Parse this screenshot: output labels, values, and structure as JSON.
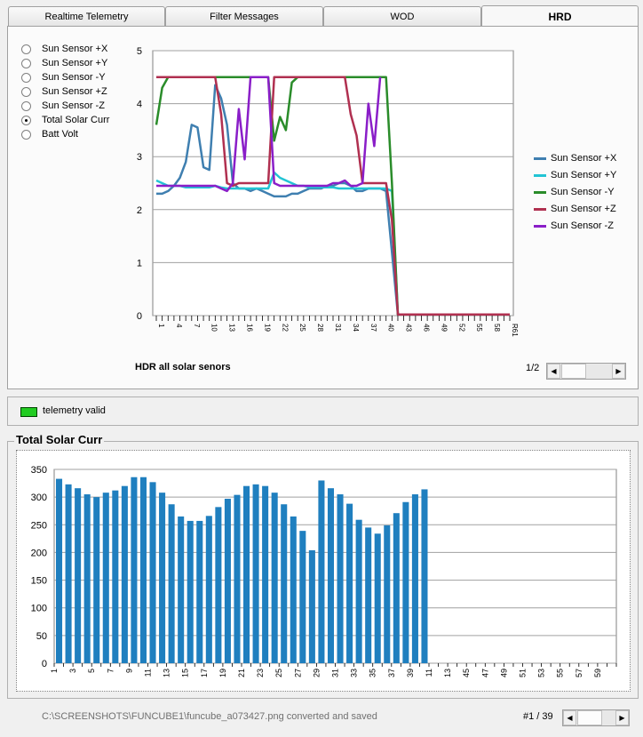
{
  "tabs": [
    {
      "label": "Realtime Telemetry"
    },
    {
      "label": "Filter Messages"
    },
    {
      "label": "WOD"
    },
    {
      "label": "HRD",
      "active": true
    }
  ],
  "radios": [
    {
      "label": "Sun Sensor +X",
      "checked": false
    },
    {
      "label": "Sun Sensor +Y",
      "checked": false
    },
    {
      "label": "Sun Sensor -Y",
      "checked": false
    },
    {
      "label": "Sun Sensor +Z",
      "checked": false
    },
    {
      "label": "Sun Sensor -Z",
      "checked": false
    },
    {
      "label": "Total Solar Curr",
      "checked": true
    },
    {
      "label": "Batt Volt",
      "checked": false
    }
  ],
  "top_chart_title": "HDR  all solar senors",
  "page_indicator": "1/2",
  "status": {
    "label": "telemetry valid",
    "color": "#22cc22"
  },
  "bottom_group_title": "Total Solar Curr",
  "footer": {
    "message": "C:\\SCREENSHOTS\\FUNCUBE1\\funcube_a073427.png converted and saved",
    "frame_counter": "#1 / 39"
  },
  "chart_data": [
    {
      "type": "line",
      "title": "HDR  all solar senors",
      "ylim": [
        0,
        5
      ],
      "yticks": [
        "0",
        "1",
        "2",
        "3",
        "4",
        "5"
      ],
      "xticks": [
        "1",
        "4",
        "7",
        "10",
        "13",
        "16",
        "19",
        "22",
        "25",
        "28",
        "31",
        "34",
        "37",
        "40",
        "43",
        "46",
        "49",
        "52",
        "55",
        "58",
        "R61"
      ],
      "x": [
        1,
        2,
        3,
        4,
        5,
        6,
        7,
        8,
        9,
        10,
        11,
        12,
        13,
        14,
        15,
        16,
        17,
        18,
        19,
        20,
        21,
        22,
        23,
        24,
        25,
        26,
        27,
        28,
        29,
        30,
        31,
        32,
        33,
        34,
        35,
        36,
        37,
        38,
        39,
        40,
        41,
        42,
        43,
        44,
        45,
        46,
        47,
        48,
        49,
        50,
        51,
        52,
        53,
        54,
        55,
        56,
        57,
        58,
        59,
        60,
        61
      ],
      "series": [
        {
          "name": "Sun Sensor +X",
          "color": "#3f7fb0",
          "values": [
            2.3,
            2.3,
            2.35,
            2.45,
            2.6,
            2.9,
            3.6,
            3.55,
            2.8,
            2.75,
            4.35,
            4.1,
            3.6,
            2.5,
            2.4,
            2.4,
            2.35,
            2.4,
            2.35,
            2.3,
            2.25,
            2.25,
            2.25,
            2.3,
            2.3,
            2.35,
            2.4,
            2.4,
            2.4,
            2.45,
            2.45,
            2.5,
            2.5,
            2.45,
            2.35,
            2.35,
            2.4,
            2.4,
            2.4,
            2.35,
            1.2,
            0.02,
            0.02,
            0.02,
            0.02,
            0.02,
            0.02,
            0.02,
            0.02,
            0.02,
            0.02,
            0.02,
            0.02,
            0.02,
            0.02,
            0.02,
            0.02,
            0.02,
            0.02,
            0.02,
            0.02
          ]
        },
        {
          "name": "Sun Sensor +Y",
          "color": "#22c4d4",
          "values": [
            2.55,
            2.5,
            2.45,
            2.45,
            2.45,
            2.42,
            2.42,
            2.42,
            2.42,
            2.42,
            2.45,
            2.42,
            2.4,
            2.4,
            2.4,
            2.4,
            2.4,
            2.4,
            2.4,
            2.4,
            2.7,
            2.6,
            2.55,
            2.5,
            2.45,
            2.45,
            2.42,
            2.42,
            2.42,
            2.42,
            2.42,
            2.4,
            2.4,
            2.4,
            2.4,
            2.4,
            2.4,
            2.4,
            2.4,
            2.4,
            2.35,
            0.02,
            0.02,
            0.02,
            0.02,
            0.02,
            0.02,
            0.02,
            0.02,
            0.02,
            0.02,
            0.02,
            0.02,
            0.02,
            0.02,
            0.02,
            0.02,
            0.02,
            0.02,
            0.02,
            0.02
          ]
        },
        {
          "name": "Sun Sensor -Y",
          "color": "#2a8c2a",
          "values": [
            3.6,
            4.3,
            4.5,
            4.5,
            4.5,
            4.5,
            4.5,
            4.5,
            4.5,
            4.5,
            4.5,
            4.5,
            4.5,
            4.5,
            4.5,
            4.5,
            4.5,
            4.5,
            4.5,
            4.5,
            3.3,
            3.75,
            3.5,
            4.4,
            4.5,
            4.5,
            4.5,
            4.5,
            4.5,
            4.5,
            4.5,
            4.5,
            4.5,
            4.5,
            4.5,
            4.5,
            4.5,
            4.5,
            4.5,
            4.5,
            2.5,
            0.02,
            0.02,
            0.02,
            0.02,
            0.02,
            0.02,
            0.02,
            0.02,
            0.02,
            0.02,
            0.02,
            0.02,
            0.02,
            0.02,
            0.02,
            0.02,
            0.02,
            0.02,
            0.02,
            0.02
          ]
        },
        {
          "name": "Sun Sensor +Z",
          "color": "#b03050",
          "values": [
            4.5,
            4.5,
            4.5,
            4.5,
            4.5,
            4.5,
            4.5,
            4.5,
            4.5,
            4.5,
            4.5,
            3.8,
            2.5,
            2.45,
            2.5,
            2.5,
            2.5,
            2.5,
            2.5,
            2.5,
            4.5,
            4.5,
            4.5,
            4.5,
            4.5,
            4.5,
            4.5,
            4.5,
            4.5,
            4.5,
            4.5,
            4.5,
            4.5,
            3.8,
            3.4,
            2.5,
            2.5,
            2.5,
            2.5,
            2.5,
            1.8,
            0.02,
            0.02,
            0.02,
            0.02,
            0.02,
            0.02,
            0.02,
            0.02,
            0.02,
            0.02,
            0.02,
            0.02,
            0.02,
            0.02,
            0.02,
            0.02,
            0.02,
            0.02,
            0.02,
            0.02
          ]
        },
        {
          "name": "Sun Sensor -Z",
          "color": "#8a1ec8",
          "values": [
            2.45,
            2.45,
            2.45,
            2.45,
            2.45,
            2.45,
            2.45,
            2.45,
            2.45,
            2.45,
            2.45,
            2.4,
            2.35,
            2.5,
            3.9,
            2.95,
            4.5,
            4.5,
            4.5,
            4.5,
            2.5,
            2.45,
            2.45,
            2.45,
            2.45,
            2.45,
            2.45,
            2.45,
            2.45,
            2.45,
            2.5,
            2.5,
            2.55,
            2.45,
            2.45,
            2.5,
            4.0,
            3.2,
            4.5,
            null,
            null,
            null,
            null,
            null,
            null,
            null,
            null,
            null,
            null,
            null,
            null,
            null,
            null,
            null,
            null,
            null,
            null,
            null,
            null,
            null,
            null
          ]
        }
      ]
    },
    {
      "type": "bar",
      "ylim": [
        0,
        350
      ],
      "yticks": [
        "0",
        "50",
        "100",
        "150",
        "200",
        "250",
        "300",
        "350"
      ],
      "xticks": [
        "1",
        "3",
        "5",
        "7",
        "9",
        "11",
        "13",
        "15",
        "17",
        "19",
        "21",
        "23",
        "25",
        "27",
        "29",
        "31",
        "33",
        "35",
        "37",
        "39",
        "11",
        "13",
        "45",
        "47",
        "49",
        "51",
        "53",
        "55",
        "57",
        "59"
      ],
      "slots": 60,
      "color": "#1f7fbf",
      "values": [
        333,
        323,
        316,
        305,
        300,
        308,
        312,
        320,
        336,
        336,
        327,
        308,
        287,
        265,
        257,
        257,
        266,
        282,
        297,
        304,
        320,
        323,
        320,
        308,
        287,
        265,
        239,
        204,
        330,
        316,
        305,
        288,
        259,
        245,
        234,
        249,
        271,
        291,
        305,
        314
      ]
    }
  ]
}
